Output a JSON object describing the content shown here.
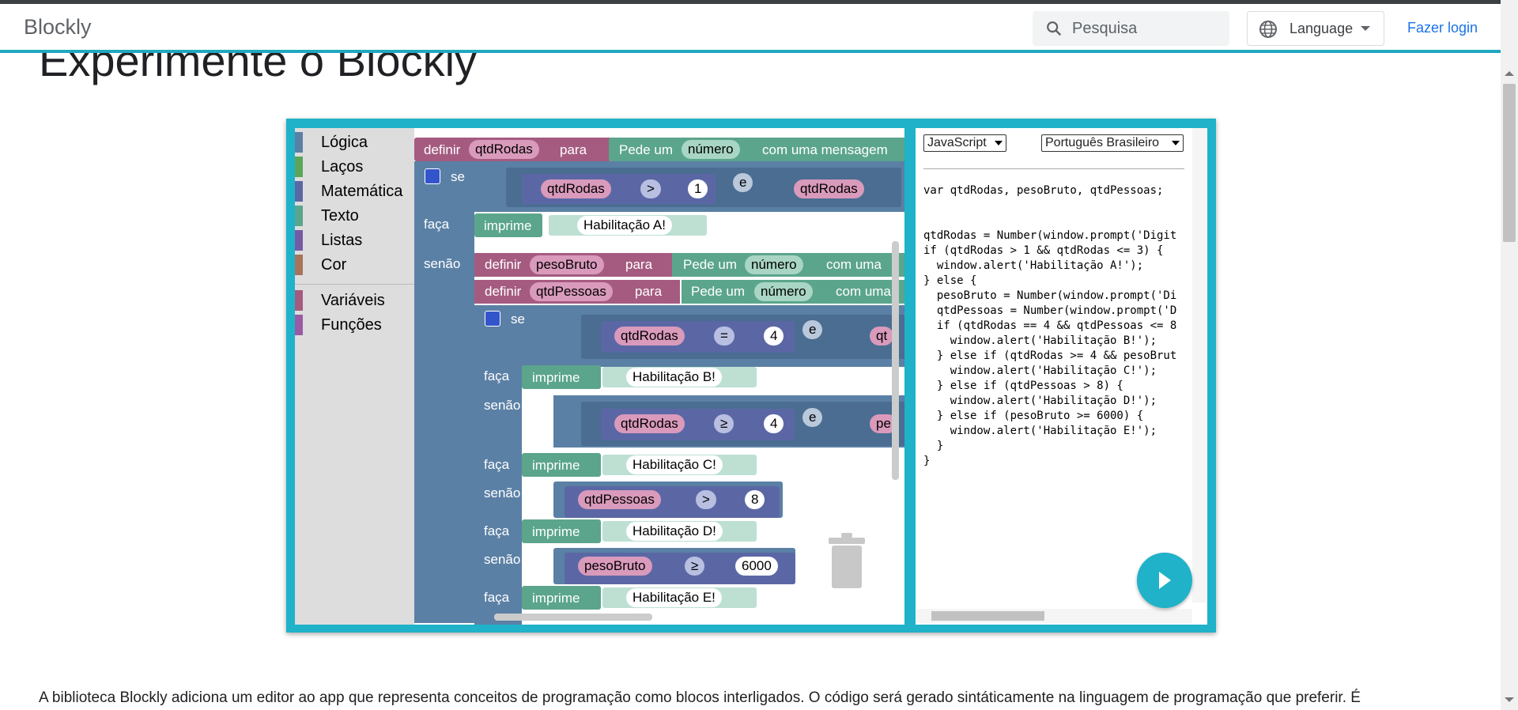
{
  "header": {
    "brand": "Blockly",
    "search_placeholder": "Pesquisa",
    "language_label": "Language",
    "login_label": "Fazer login"
  },
  "page": {
    "title": "Experimente o Blockly",
    "paragraph": "A biblioteca Blockly adiciona um editor ao app que representa conceitos de programação como blocos interligados. O código será gerado sintáticamente na linguagem de programação que preferir. É"
  },
  "toolbox": {
    "categories": [
      {
        "label": "Lógica",
        "color": "#5b80a5"
      },
      {
        "label": "Laços",
        "color": "#5ba55b"
      },
      {
        "label": "Matemática",
        "color": "#5b67a5"
      },
      {
        "label": "Texto",
        "color": "#5ba58c"
      },
      {
        "label": "Listas",
        "color": "#745ba5"
      },
      {
        "label": "Cor",
        "color": "#a5745b"
      },
      {
        "label": "Variáveis",
        "color": "#a55b80"
      },
      {
        "label": "Funções",
        "color": "#995ba5"
      }
    ]
  },
  "workspace": {
    "kw_definir": "definir",
    "kw_para": "para",
    "kw_se": "se",
    "kw_faca": "faça",
    "kw_senao": "senão",
    "kw_senao_se": "senão se",
    "kw_imprime": "imprime",
    "kw_e": "e",
    "kw_pede_um": "Pede um",
    "kw_numero": "número",
    "kw_com_mensagem": "com uma mensagem",
    "kw_com_uma": "com uma",
    "var_qtdRodas": "qtdRodas",
    "var_pesoBruto": "pesoBruto",
    "var_qtdPessoas": "qtdPessoas",
    "op_gt": ">",
    "op_eq": "=",
    "op_ge": "≥",
    "num_1": "1",
    "num_4": "4",
    "num_8": "8",
    "num_6000": "6000",
    "txt_hab_a": "Habilitação A!",
    "txt_hab_b": "Habilitação B!",
    "txt_hab_c": "Habilitação C!",
    "txt_hab_d": "Habilitação D!",
    "txt_hab_e": "Habilitação E!",
    "partial_qt": "qt",
    "partial_pe": "pe"
  },
  "code_panel": {
    "language_select": "JavaScript",
    "locale_select": "Português Brasileiro",
    "lines": [
      "var qtdRodas, pesoBruto, qtdPessoas;",
      "",
      "",
      "qtdRodas = Number(window.prompt('Digit",
      "if (qtdRodas > 1 && qtdRodas <= 3) {",
      "  window.alert('Habilitação A!');",
      "} else {",
      "  pesoBruto = Number(window.prompt('Di",
      "  qtdPessoas = Number(window.prompt('D",
      "  if (qtdRodas == 4 && qtdPessoas <= 8",
      "    window.alert('Habilitação B!');",
      "  } else if (qtdRodas >= 4 && pesoBrut",
      "    window.alert('Habilitação C!');",
      "  } else if (qtdPessoas > 8) {",
      "    window.alert('Habilitação D!');",
      "  } else if (pesoBruto >= 6000) {",
      "    window.alert('Habilitação E!');",
      "  }",
      "}"
    ]
  },
  "colors": {
    "accent": "#1fb2c9",
    "variable_block": "#a55b80",
    "logic_block": "#5b80a5",
    "text_block": "#5ba58c",
    "math_block": "#5b67a5",
    "link": "#1a73e8"
  }
}
